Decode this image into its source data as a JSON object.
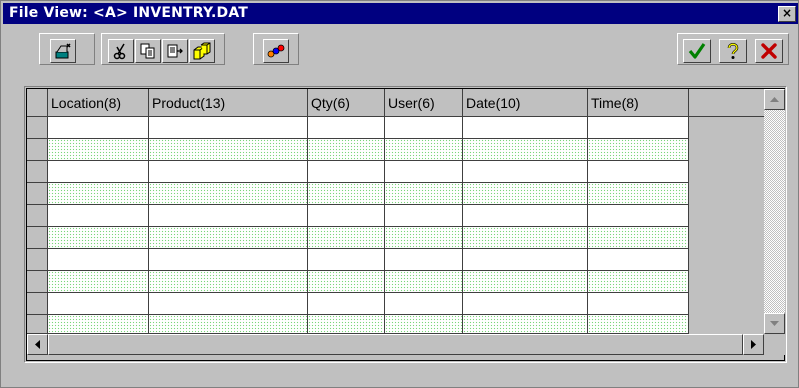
{
  "window": {
    "title": "File View: <A> INVENTRY.DAT",
    "close_glyph": "×"
  },
  "toolbar": {
    "left_buttons": [
      {
        "icon": "add-record-icon"
      },
      {
        "icon": "scissors-icon"
      },
      {
        "icon": "copy-icon"
      },
      {
        "icon": "paste-icon"
      },
      {
        "icon": "cubes-icon"
      },
      {
        "icon": "abc-icon"
      }
    ],
    "right_buttons": [
      {
        "icon": "check-icon",
        "color": "#008000"
      },
      {
        "icon": "question-icon",
        "color": "#808000"
      },
      {
        "icon": "x-icon",
        "color": "#c00000"
      }
    ]
  },
  "grid": {
    "columns": [
      "Location(8)",
      "Product(13)",
      "Qty(6)",
      "User(6)",
      "Date(10)",
      "Time(8)"
    ],
    "row_count": 10,
    "alt_row_color": "#7ad67a",
    "rows": [
      [
        "",
        "",
        "",
        "",
        "",
        ""
      ],
      [
        "",
        "",
        "",
        "",
        "",
        ""
      ],
      [
        "",
        "",
        "",
        "",
        "",
        ""
      ],
      [
        "",
        "",
        "",
        "",
        "",
        ""
      ],
      [
        "",
        "",
        "",
        "",
        "",
        ""
      ],
      [
        "",
        "",
        "",
        "",
        "",
        ""
      ],
      [
        "",
        "",
        "",
        "",
        "",
        ""
      ],
      [
        "",
        "",
        "",
        "",
        "",
        ""
      ],
      [
        "",
        "",
        "",
        "",
        "",
        ""
      ],
      [
        "",
        "",
        "",
        "",
        "",
        ""
      ]
    ]
  }
}
